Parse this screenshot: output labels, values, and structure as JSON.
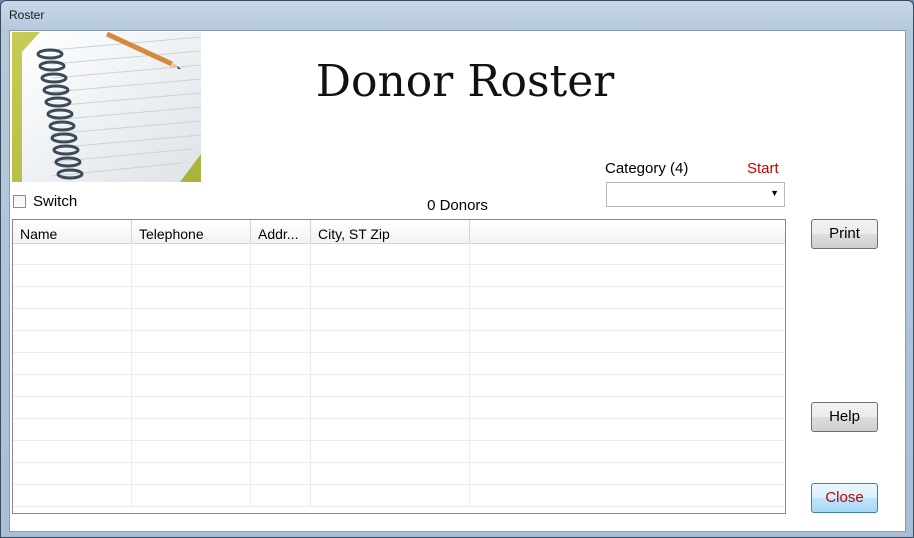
{
  "window": {
    "title": "Roster"
  },
  "header": {
    "title": "Donor Roster"
  },
  "switch": {
    "label": "Switch",
    "checked": false
  },
  "donors": {
    "count_label": "0 Donors"
  },
  "category": {
    "label": "Category (4)",
    "start_label": "Start",
    "selected": ""
  },
  "grid": {
    "columns": [
      "Name",
      "Telephone",
      "Addr...",
      "City, ST Zip",
      ""
    ],
    "rows": []
  },
  "buttons": {
    "print": "Print",
    "help": "Help",
    "close": "Close"
  },
  "colors": {
    "accent_red": "#cc0000",
    "titlebar": "#b5c9de"
  },
  "icons": {
    "notebook": "notebook-image",
    "dropdown": "chevron-down-icon"
  }
}
